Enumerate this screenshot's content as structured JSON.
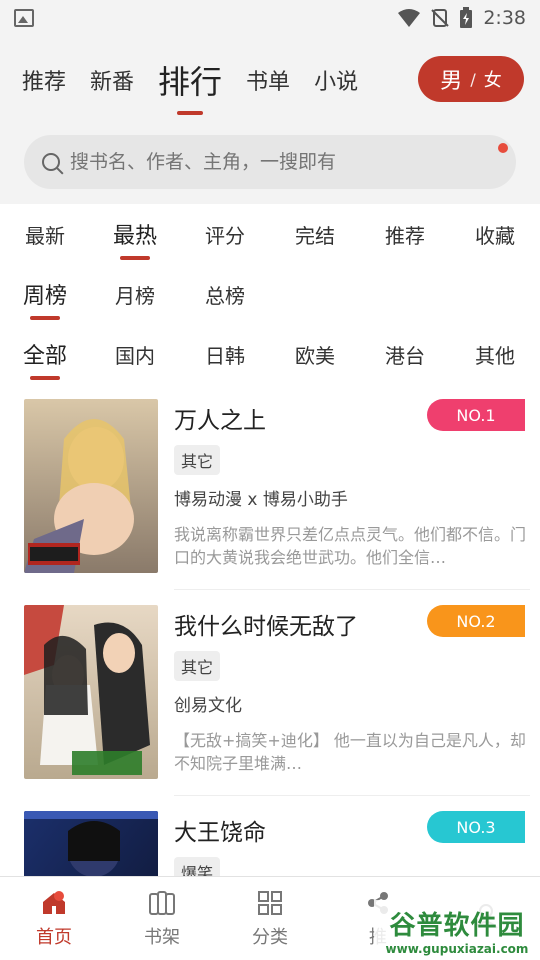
{
  "status_bar": {
    "time": "2:38"
  },
  "top_tabs": [
    {
      "label": "推荐"
    },
    {
      "label": "新番"
    },
    {
      "label": "排行",
      "active": true
    },
    {
      "label": "书单"
    },
    {
      "label": "小说"
    }
  ],
  "gender_toggle": {
    "male": "男",
    "sep": "/",
    "female": "女"
  },
  "search": {
    "placeholder": "搜书名、作者、主角，一搜即有"
  },
  "filters": {
    "sort": [
      {
        "label": "最新"
      },
      {
        "label": "最热",
        "active": true
      },
      {
        "label": "评分"
      },
      {
        "label": "完结"
      },
      {
        "label": "推荐"
      },
      {
        "label": "收藏"
      }
    ],
    "period": [
      {
        "label": "周榜",
        "active": true
      },
      {
        "label": "月榜"
      },
      {
        "label": "总榜"
      }
    ],
    "region": [
      {
        "label": "全部",
        "active": true
      },
      {
        "label": "国内"
      },
      {
        "label": "日韩"
      },
      {
        "label": "欧美"
      },
      {
        "label": "港台"
      },
      {
        "label": "其他"
      }
    ]
  },
  "books": [
    {
      "title": "万人之上",
      "tag": "其它",
      "author": "博易动漫 x 博易小助手",
      "desc": "我说离称霸世界只差亿点点灵气。他们都不信。门口的大黄说我会绝世武功。他们全信…",
      "rank": "NO.1",
      "rank_color": "#ef3f6e"
    },
    {
      "title": "我什么时候无敌了",
      "tag": "其它",
      "author": "创易文化",
      "desc": "【无敌+搞笑+迪化】 他一直以为自己是凡人，却不知院子里堆满…",
      "rank": "NO.2",
      "rank_color": "#f9951b"
    },
    {
      "title": "大王饶命",
      "tag": "爆笑",
      "author": "",
      "desc": "",
      "rank": "NO.3",
      "rank_color": "#27c7d2"
    }
  ],
  "bottom_nav": [
    {
      "label": "首页",
      "icon": "home-icon",
      "active": true
    },
    {
      "label": "书架",
      "icon": "bookshelf-icon"
    },
    {
      "label": "分类",
      "icon": "category-icon"
    },
    {
      "label": "推",
      "icon": "share-icon"
    },
    {
      "label": "",
      "icon": "profile-icon"
    }
  ],
  "watermark": {
    "main": "谷普软件园",
    "sub": "www.gupuxiazai.com"
  },
  "colors": {
    "accent": "#c0392b"
  }
}
